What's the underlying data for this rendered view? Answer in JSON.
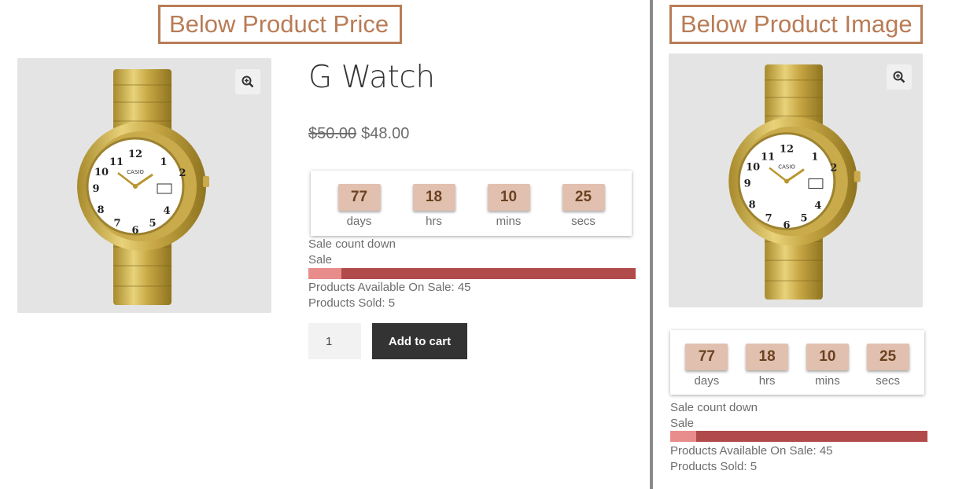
{
  "left_section": {
    "heading": "Below Product Price",
    "product": {
      "title": "G Watch",
      "regular_price": "$50.00",
      "sale_price": "$48.00",
      "quantity": "1",
      "add_to_cart_label": "Add to cart"
    },
    "countdown": [
      {
        "value": "77",
        "label": "days"
      },
      {
        "value": "18",
        "label": "hrs"
      },
      {
        "value": "10",
        "label": "mins"
      },
      {
        "value": "25",
        "label": "secs"
      }
    ],
    "sale_countdown_label": "Sale count down",
    "sale_label": "Sale",
    "sold_fraction": 0.1,
    "available_text": "Products Available On Sale: 45",
    "sold_text": "Products Sold: 5"
  },
  "right_section": {
    "heading": "Below Product Image",
    "countdown": [
      {
        "value": "77",
        "label": "days"
      },
      {
        "value": "18",
        "label": "hrs"
      },
      {
        "value": "10",
        "label": "mins"
      },
      {
        "value": "25",
        "label": "secs"
      }
    ],
    "sale_countdown_label": "Sale count down",
    "sale_label": "Sale",
    "sold_fraction": 0.1,
    "available_text": "Products Available On Sale: 45",
    "sold_text": "Products Sold: 5"
  },
  "colors": {
    "label_border": "#b97c56",
    "countdown_tile": "#e2c0b0",
    "progress_bar": "#b14a4a",
    "progress_fill": "#e88c8c",
    "button": "#333333"
  },
  "icons": {
    "zoom": "zoom-in-icon"
  }
}
